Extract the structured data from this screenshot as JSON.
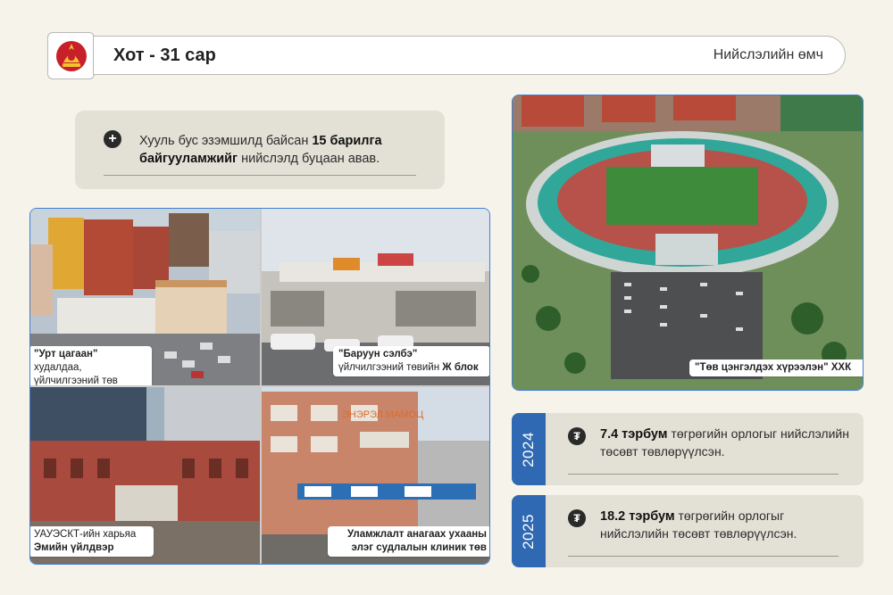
{
  "header": {
    "title": "Хот - 31 сар",
    "right_label": "Нийслэлийн өмч",
    "logo": "city-emblem-icon"
  },
  "info": {
    "icon": "plus-circle-icon",
    "text_before": "Хууль бус эзэмшилд байсан ",
    "text_bold": "15 барилга байгууламжийг",
    "text_after": " нийслэлд буцаан авав."
  },
  "photos": [
    {
      "caption_quote": "\"Урт цагаан\"",
      "caption_rest": " худалдаа, үйлчилгээний төв",
      "caption_bold": ""
    },
    {
      "caption_quote": "\"Баруун сэлбэ\"",
      "caption_rest": " үйлчилгээний төвийн ",
      "caption_bold": "Ж блок"
    },
    {
      "caption_quote": "",
      "caption_rest": "УАУЭСКТ-ийн харьяа",
      "caption_bold": "Эмийн үйлдвэр"
    },
    {
      "caption_quote": "",
      "caption_rest": "",
      "caption_bold": "Уламжлалт анагаах ухааны элэг судлалын клиник төв"
    }
  ],
  "stadium": {
    "caption_quote": "\"Төв цэнгэлдэх хүрээлэн\"",
    "caption_rest": " ХХК",
    "sign_text": "ЭНЭРЭЛ МАМОЦ"
  },
  "years": [
    {
      "year": "2024",
      "icon": "tugrik-icon",
      "amount": "7.4 тэрбум",
      "text": " төгрөгийн орлогыг нийслэлийн төсөвт төвлөрүүлсэн."
    },
    {
      "year": "2025",
      "icon": "tugrik-icon",
      "amount": "18.2 тэрбум",
      "text": " төгрөгийн орлогыг нийслэлийн төсөвт төвлөрүүлсэн."
    }
  ],
  "colors": {
    "accent": "#2f69b3",
    "panel": "#e3e1d6",
    "background": "#f6f3ea"
  }
}
